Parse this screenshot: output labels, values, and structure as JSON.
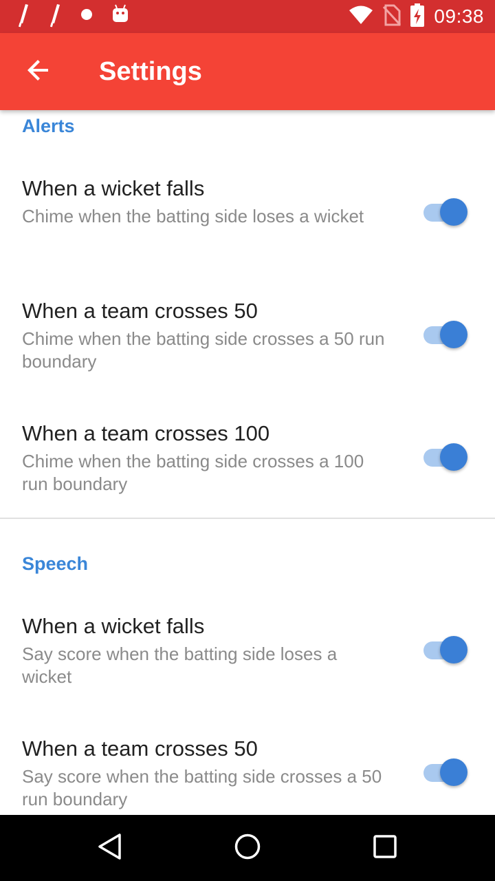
{
  "status_bar": {
    "time": "09:38",
    "icons": [
      "cricket-bat-icon",
      "cricket-bat-icon",
      "dot-icon",
      "android-icon",
      "wifi-icon",
      "no-sim-icon",
      "battery-charging-icon"
    ]
  },
  "app_bar": {
    "title": "Settings",
    "back_icon": "arrow-back-icon"
  },
  "sections": [
    {
      "title": "Alerts",
      "items": [
        {
          "title": "When a wicket falls",
          "summary": "Chime when the batting side loses a wicket",
          "enabled": true
        },
        {
          "title": "When a team crosses 50",
          "summary": "Chime when the batting side crosses a 50 run boundary",
          "enabled": true
        },
        {
          "title": "When a team crosses 100",
          "summary": "Chime when the batting side crosses a 100 run boundary",
          "enabled": true
        }
      ]
    },
    {
      "title": "Speech",
      "items": [
        {
          "title": "When a wicket falls",
          "summary": "Say score when the batting side loses a wicket",
          "enabled": true
        },
        {
          "title": "When a team crosses 50",
          "summary": "Say score when the batting side crosses a 50 run boundary",
          "enabled": true
        }
      ]
    }
  ],
  "nav_bar": {
    "back_icon": "nav-back-icon",
    "home_icon": "nav-home-icon",
    "recents_icon": "nav-recents-icon"
  },
  "colors": {
    "status_bar": "#d32f2f",
    "app_bar": "#f44336",
    "accent": "#3a7fd6",
    "category_text": "#3a86d8"
  }
}
